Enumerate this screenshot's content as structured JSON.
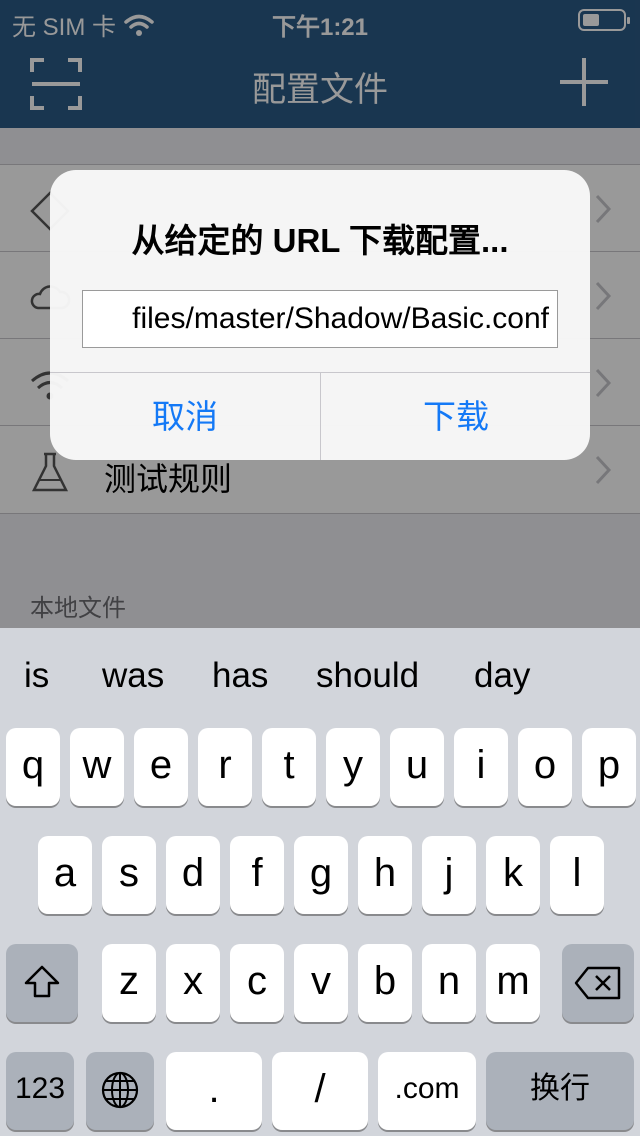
{
  "status_bar": {
    "carrier": "无 SIM 卡",
    "time": "下午1:21"
  },
  "nav": {
    "title": "配置文件"
  },
  "list": {
    "items": [
      {
        "label": ""
      },
      {
        "label": ""
      },
      {
        "label": ""
      },
      {
        "label": "测试规则"
      }
    ],
    "section_header": "本地文件"
  },
  "alert": {
    "title": "从给定的 URL 下载配置...",
    "field_value": "files/master/Shadow/Basic.conf",
    "cancel_label": "取消",
    "ok_label": "下载"
  },
  "keyboard": {
    "suggestions": [
      "is",
      "was",
      "has",
      "should",
      "day"
    ],
    "row1": [
      "q",
      "w",
      "e",
      "r",
      "t",
      "y",
      "u",
      "i",
      "o",
      "p"
    ],
    "row2": [
      "a",
      "s",
      "d",
      "f",
      "g",
      "h",
      "j",
      "k",
      "l"
    ],
    "row3": [
      "z",
      "x",
      "c",
      "v",
      "b",
      "n",
      "m"
    ],
    "key_123": "123",
    "key_dot": ".",
    "key_slash": "/",
    "key_com": ".com",
    "key_return": "换行"
  },
  "colors": {
    "nav_bg": "#2b5a86",
    "accent": "#1479f6",
    "keyboard_bg": "#d2d5db"
  }
}
